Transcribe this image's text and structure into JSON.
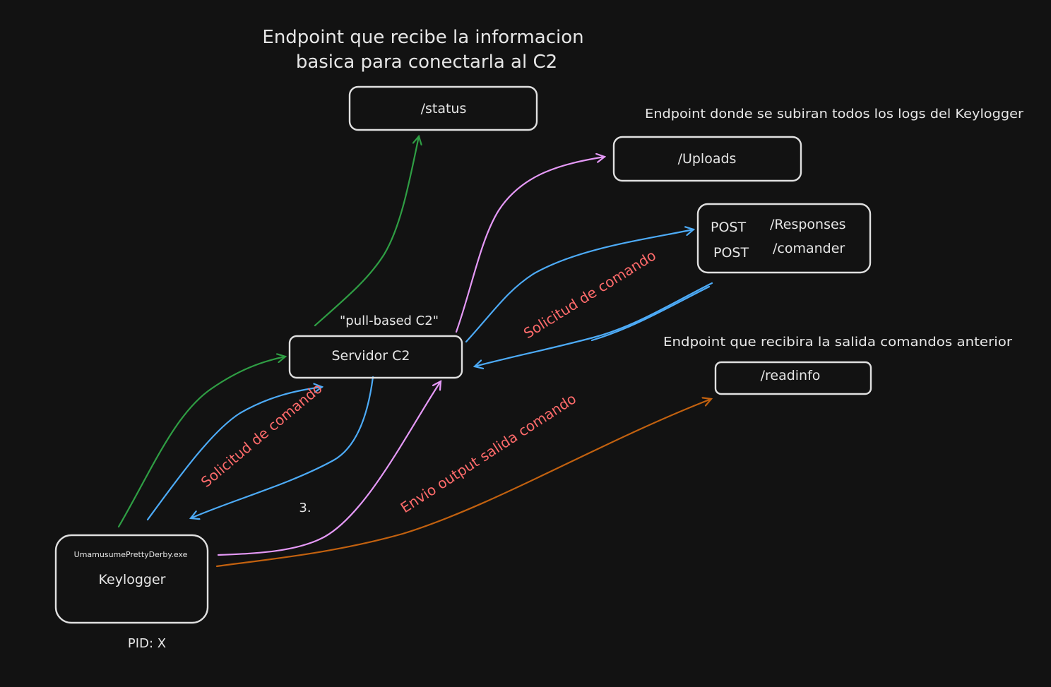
{
  "colors": {
    "background": "#121212",
    "box_stroke": "#e0e0e0",
    "text": "#e6e6e6",
    "green": "#2f9e44",
    "blue": "#4dabf7",
    "violet": "#e599f7",
    "orange": "#c2610f",
    "red_label": "#ff6b6b"
  },
  "notes": {
    "status_line1": "Endpoint que recibe la informacion",
    "status_line2": "basica para conectarla al C2",
    "uploads": "Endpoint donde se subiran todos los logs del Keylogger",
    "readinfo": "Endpoint que recibira la salida comandos anterior",
    "pull_based": "\"pull-based C2\"",
    "step": "3.",
    "pid": "PID: X"
  },
  "nodes": {
    "status": "/status",
    "uploads": "/Uploads",
    "readinfo": "/readinfo",
    "server": "Servidor C2",
    "keylogger_exe": "UmamusumePrettyDerby.exe",
    "keylogger": "Keylogger",
    "post_method_1": "POST",
    "post_path_1": "/Responses",
    "post_method_2": "POST",
    "post_path_2": "/comander"
  },
  "edge_labels": {
    "solicitud_1": "Solicitud de comando",
    "solicitud_2": "Solicitud de comando",
    "envio": "Envio output salida comando"
  }
}
